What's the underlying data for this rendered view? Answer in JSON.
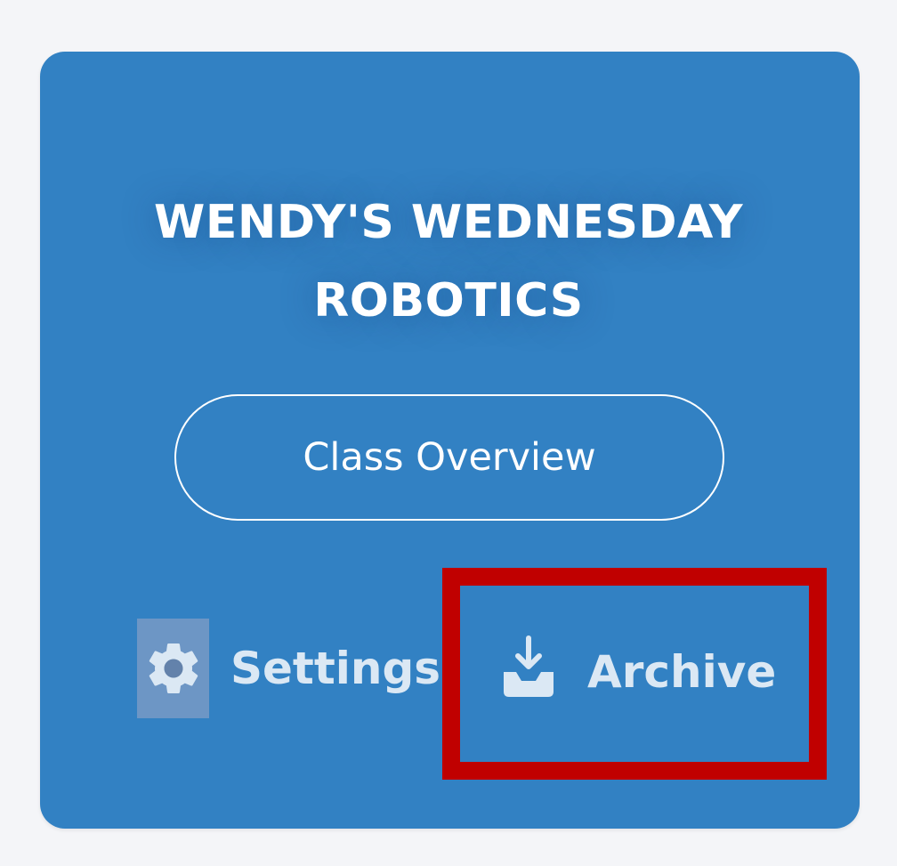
{
  "card": {
    "title_line1": "WENDY'S WEDNESDAY",
    "title_line2": "ROBOTICS",
    "overview_label": "Class Overview",
    "settings_label": "Settings",
    "archive_label": "Archive",
    "settings_icon": "gear-icon",
    "archive_icon": "inbox-download-icon"
  },
  "colors": {
    "card_background": "#3281c3",
    "page_background": "#f4f5f8",
    "highlight": "#c00000"
  }
}
